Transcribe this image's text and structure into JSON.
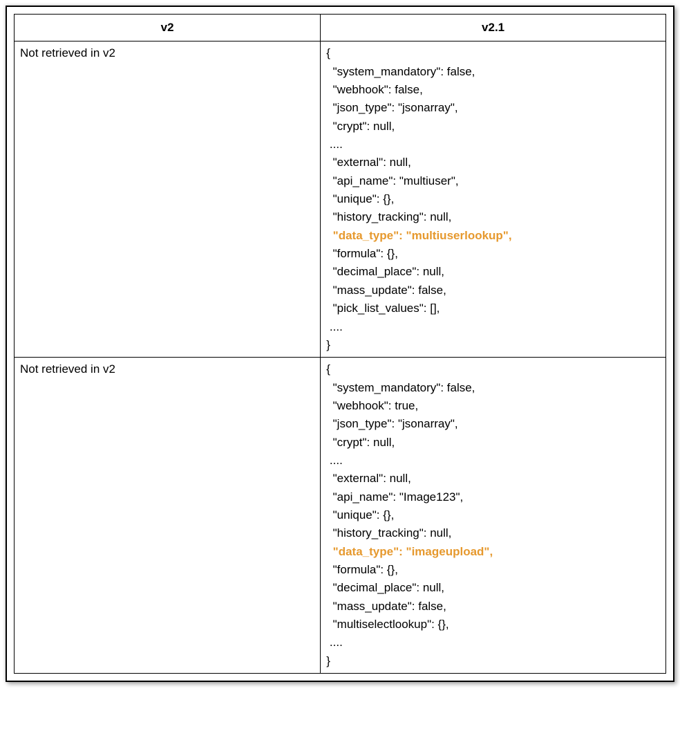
{
  "headers": {
    "v2": "v2",
    "v21": "v2.1"
  },
  "rows": [
    {
      "left": "Not retrieved in v2",
      "right_pre": "{\n  \"system_mandatory\": false,\n  \"webhook\": false,\n  \"json_type\": \"jsonarray\",\n  \"crypt\": null,\n ....\n  \"external\": null,\n  \"api_name\": \"multiuser\",\n  \"unique\": {},\n  \"history_tracking\": null,\n",
      "right_hl": "  \"data_type\": \"multiuserlookup\",",
      "right_post": "\n  \"formula\": {},\n  \"decimal_place\": null,\n  \"mass_update\": false,\n  \"pick_list_values\": [],\n ....\n}"
    },
    {
      "left": "Not retrieved in v2",
      "right_pre": "{\n  \"system_mandatory\": false,\n  \"webhook\": true,\n  \"json_type\": \"jsonarray\",\n  \"crypt\": null,\n ....\n  \"external\": null,\n  \"api_name\": \"Image123\",\n  \"unique\": {},\n  \"history_tracking\": null,\n",
      "right_hl": "  \"data_type\": \"imageupload\",",
      "right_post": "\n  \"formula\": {},\n  \"decimal_place\": null,\n  \"mass_update\": false,\n  \"multiselectlookup\": {},\n ....\n}"
    }
  ]
}
